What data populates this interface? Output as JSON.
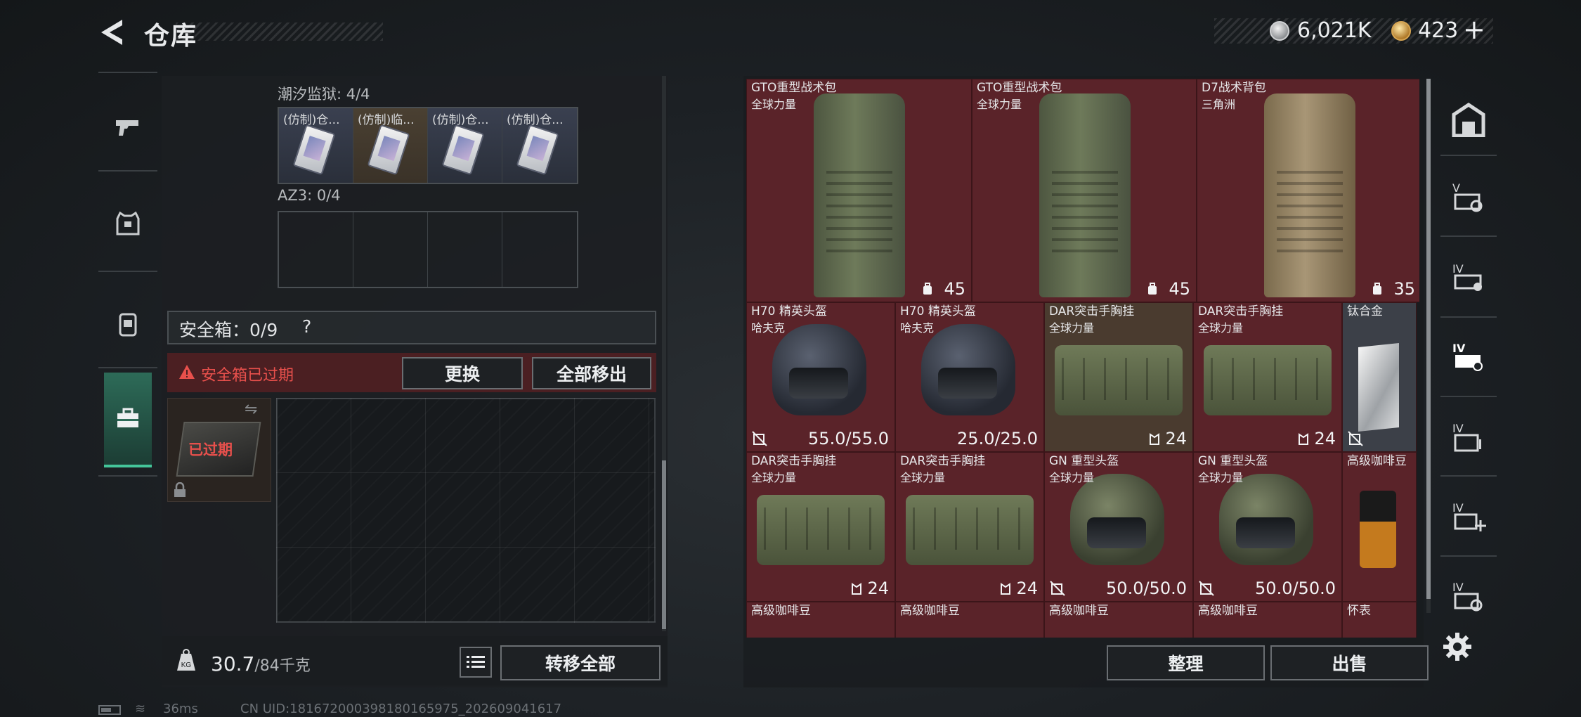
{
  "header": {
    "title": "仓库",
    "currency": [
      {
        "icon": "silver-coin-icon",
        "value": "6,021K"
      },
      {
        "icon": "gold-coin-icon",
        "value": "423"
      }
    ],
    "plus": "+"
  },
  "left_sidebar": {
    "tabs": [
      {
        "icon": "pistol-icon"
      },
      {
        "icon": "armor-vest-icon"
      },
      {
        "icon": "backpack-icon"
      },
      {
        "icon": "toolbox-icon",
        "active": true
      }
    ]
  },
  "equipment": {
    "tidal_label": "潮汐监狱: 4/4",
    "tidal_slots": [
      {
        "name": "(仿制)仓..."
      },
      {
        "name": "(仿制)临..."
      },
      {
        "name": "(仿制)仓..."
      },
      {
        "name": "(仿制)仓..."
      }
    ],
    "az3_label": "AZ3: 0/4"
  },
  "safe_box": {
    "title": "安全箱：0/9",
    "help": "?",
    "expired_warning": "安全箱已过期",
    "replace_button": "更换",
    "move_out_button": "全部移出",
    "case_badge": "已过期"
  },
  "weight": {
    "current": "30.7",
    "max": "/84千克",
    "transfer_button": "转移全部"
  },
  "inventory": {
    "items": [
      {
        "name": "GTO重型战术包",
        "sub": "全球力量",
        "stat": "45",
        "color": "red"
      },
      {
        "name": "GTO重型战术包",
        "sub": "全球力量",
        "stat": "45",
        "color": "red"
      },
      {
        "name": "D7战术背包",
        "sub": "三角洲",
        "stat": "35",
        "color": "red"
      },
      {
        "name": "H70 精英头盔",
        "sub": "哈夫克",
        "stat": "55.0/55.0",
        "color": "red"
      },
      {
        "name": "H70 精英头盔",
        "sub": "哈夫克",
        "stat": "25.0/25.0",
        "color": "red"
      },
      {
        "name": "DAR突击手胸挂",
        "sub": "全球力量",
        "stat": "24",
        "color": "tan"
      },
      {
        "name": "DAR突击手胸挂",
        "sub": "全球力量",
        "stat": "24",
        "color": "red"
      },
      {
        "name": "钛合金",
        "sub": "",
        "stat": "",
        "color": "grey"
      },
      {
        "name": "DAR突击手胸挂",
        "sub": "全球力量",
        "stat": "24",
        "color": "red"
      },
      {
        "name": "DAR突击手胸挂",
        "sub": "全球力量",
        "stat": "24",
        "color": "red"
      },
      {
        "name": "GN 重型头盔",
        "sub": "全球力量",
        "stat": "50.0/50.0",
        "color": "red"
      },
      {
        "name": "GN 重型头盔",
        "sub": "全球力量",
        "stat": "50.0/50.0",
        "color": "red"
      },
      {
        "name": "高级咖啡豆",
        "sub": "",
        "stat": "",
        "color": "red"
      },
      {
        "name": "高级咖啡豆",
        "sub": "",
        "stat": "",
        "color": "red"
      },
      {
        "name": "高级咖啡豆",
        "sub": "",
        "stat": "",
        "color": "red"
      },
      {
        "name": "高级咖啡豆",
        "sub": "",
        "stat": "",
        "color": "red"
      },
      {
        "name": "高级咖啡豆",
        "sub": "",
        "stat": "",
        "color": "red"
      },
      {
        "name": "怀表",
        "sub": "",
        "stat": "",
        "color": "red"
      }
    ],
    "sort_button": "整理",
    "sell_button": "出售"
  },
  "status_bar": {
    "ping": "36ms",
    "uid": "CN UID:18167200039818016597​5_202609041617"
  }
}
